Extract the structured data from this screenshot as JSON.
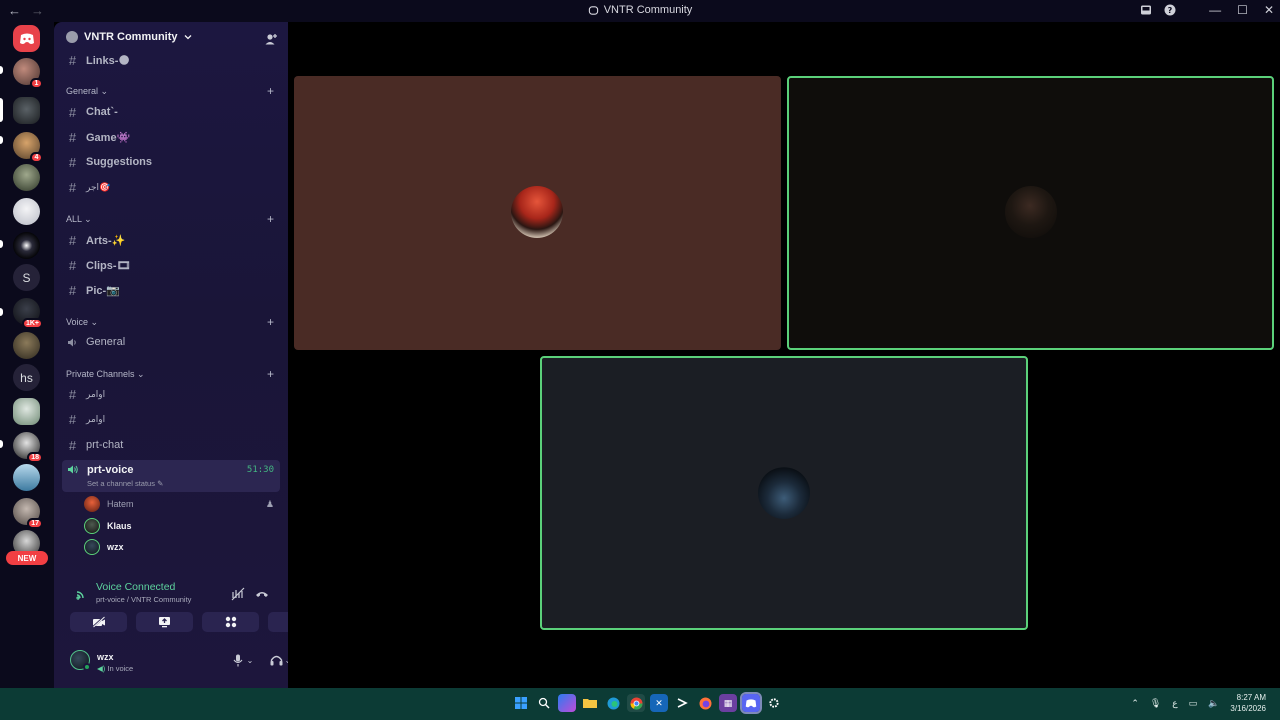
{
  "window": {
    "title": "VNTR Community",
    "back": "←",
    "forward": "→",
    "minimize": "—",
    "maximize": "☐",
    "close": "✕"
  },
  "rail": {
    "badges": [
      "1",
      "4",
      "1K+",
      "18",
      "17"
    ],
    "letter_servers": [
      "S",
      "hs"
    ],
    "new_label": "NEW"
  },
  "sidebar": {
    "server_name": "VNTR Community",
    "top_channel": "Links-🌑",
    "categories": [
      {
        "label": "General ⌄"
      },
      {
        "label": "ALL ⌄"
      },
      {
        "label": "Voice ⌄"
      },
      {
        "label": "Private Channels ⌄"
      }
    ],
    "general_channels": [
      "Chat`-",
      "Game👾",
      "Suggestions",
      "اجر🎯"
    ],
    "all_channels": [
      "Arts-✨",
      "Clips-🎞",
      "Pic-📷"
    ],
    "voice_channels": [
      "General"
    ],
    "private_channels": [
      "اوامر",
      "اوامر",
      "prt-chat"
    ],
    "active_voice": {
      "name": "prt-voice",
      "timer": "51:30",
      "status": "Set a channel status"
    },
    "voice_users": [
      {
        "name": "Hatem"
      },
      {
        "name": "Klaus"
      },
      {
        "name": "wzx"
      }
    ]
  },
  "voice_panel": {
    "title": "Voice Connected",
    "subtitle": "prt-voice / VNTR Community"
  },
  "user_panel": {
    "username": "wzx",
    "status": "In voice"
  },
  "taskbar": {
    "time": "8:27 AM",
    "date": "3/16/2026",
    "lang": "ع"
  },
  "colors": {
    "accent_green": "#5dd39e",
    "speaking_border": "#5bd17a",
    "tile_brown": "#4a2b25",
    "tile_dark": "#0f0d0b",
    "tile_slate": "#1b1e24"
  }
}
